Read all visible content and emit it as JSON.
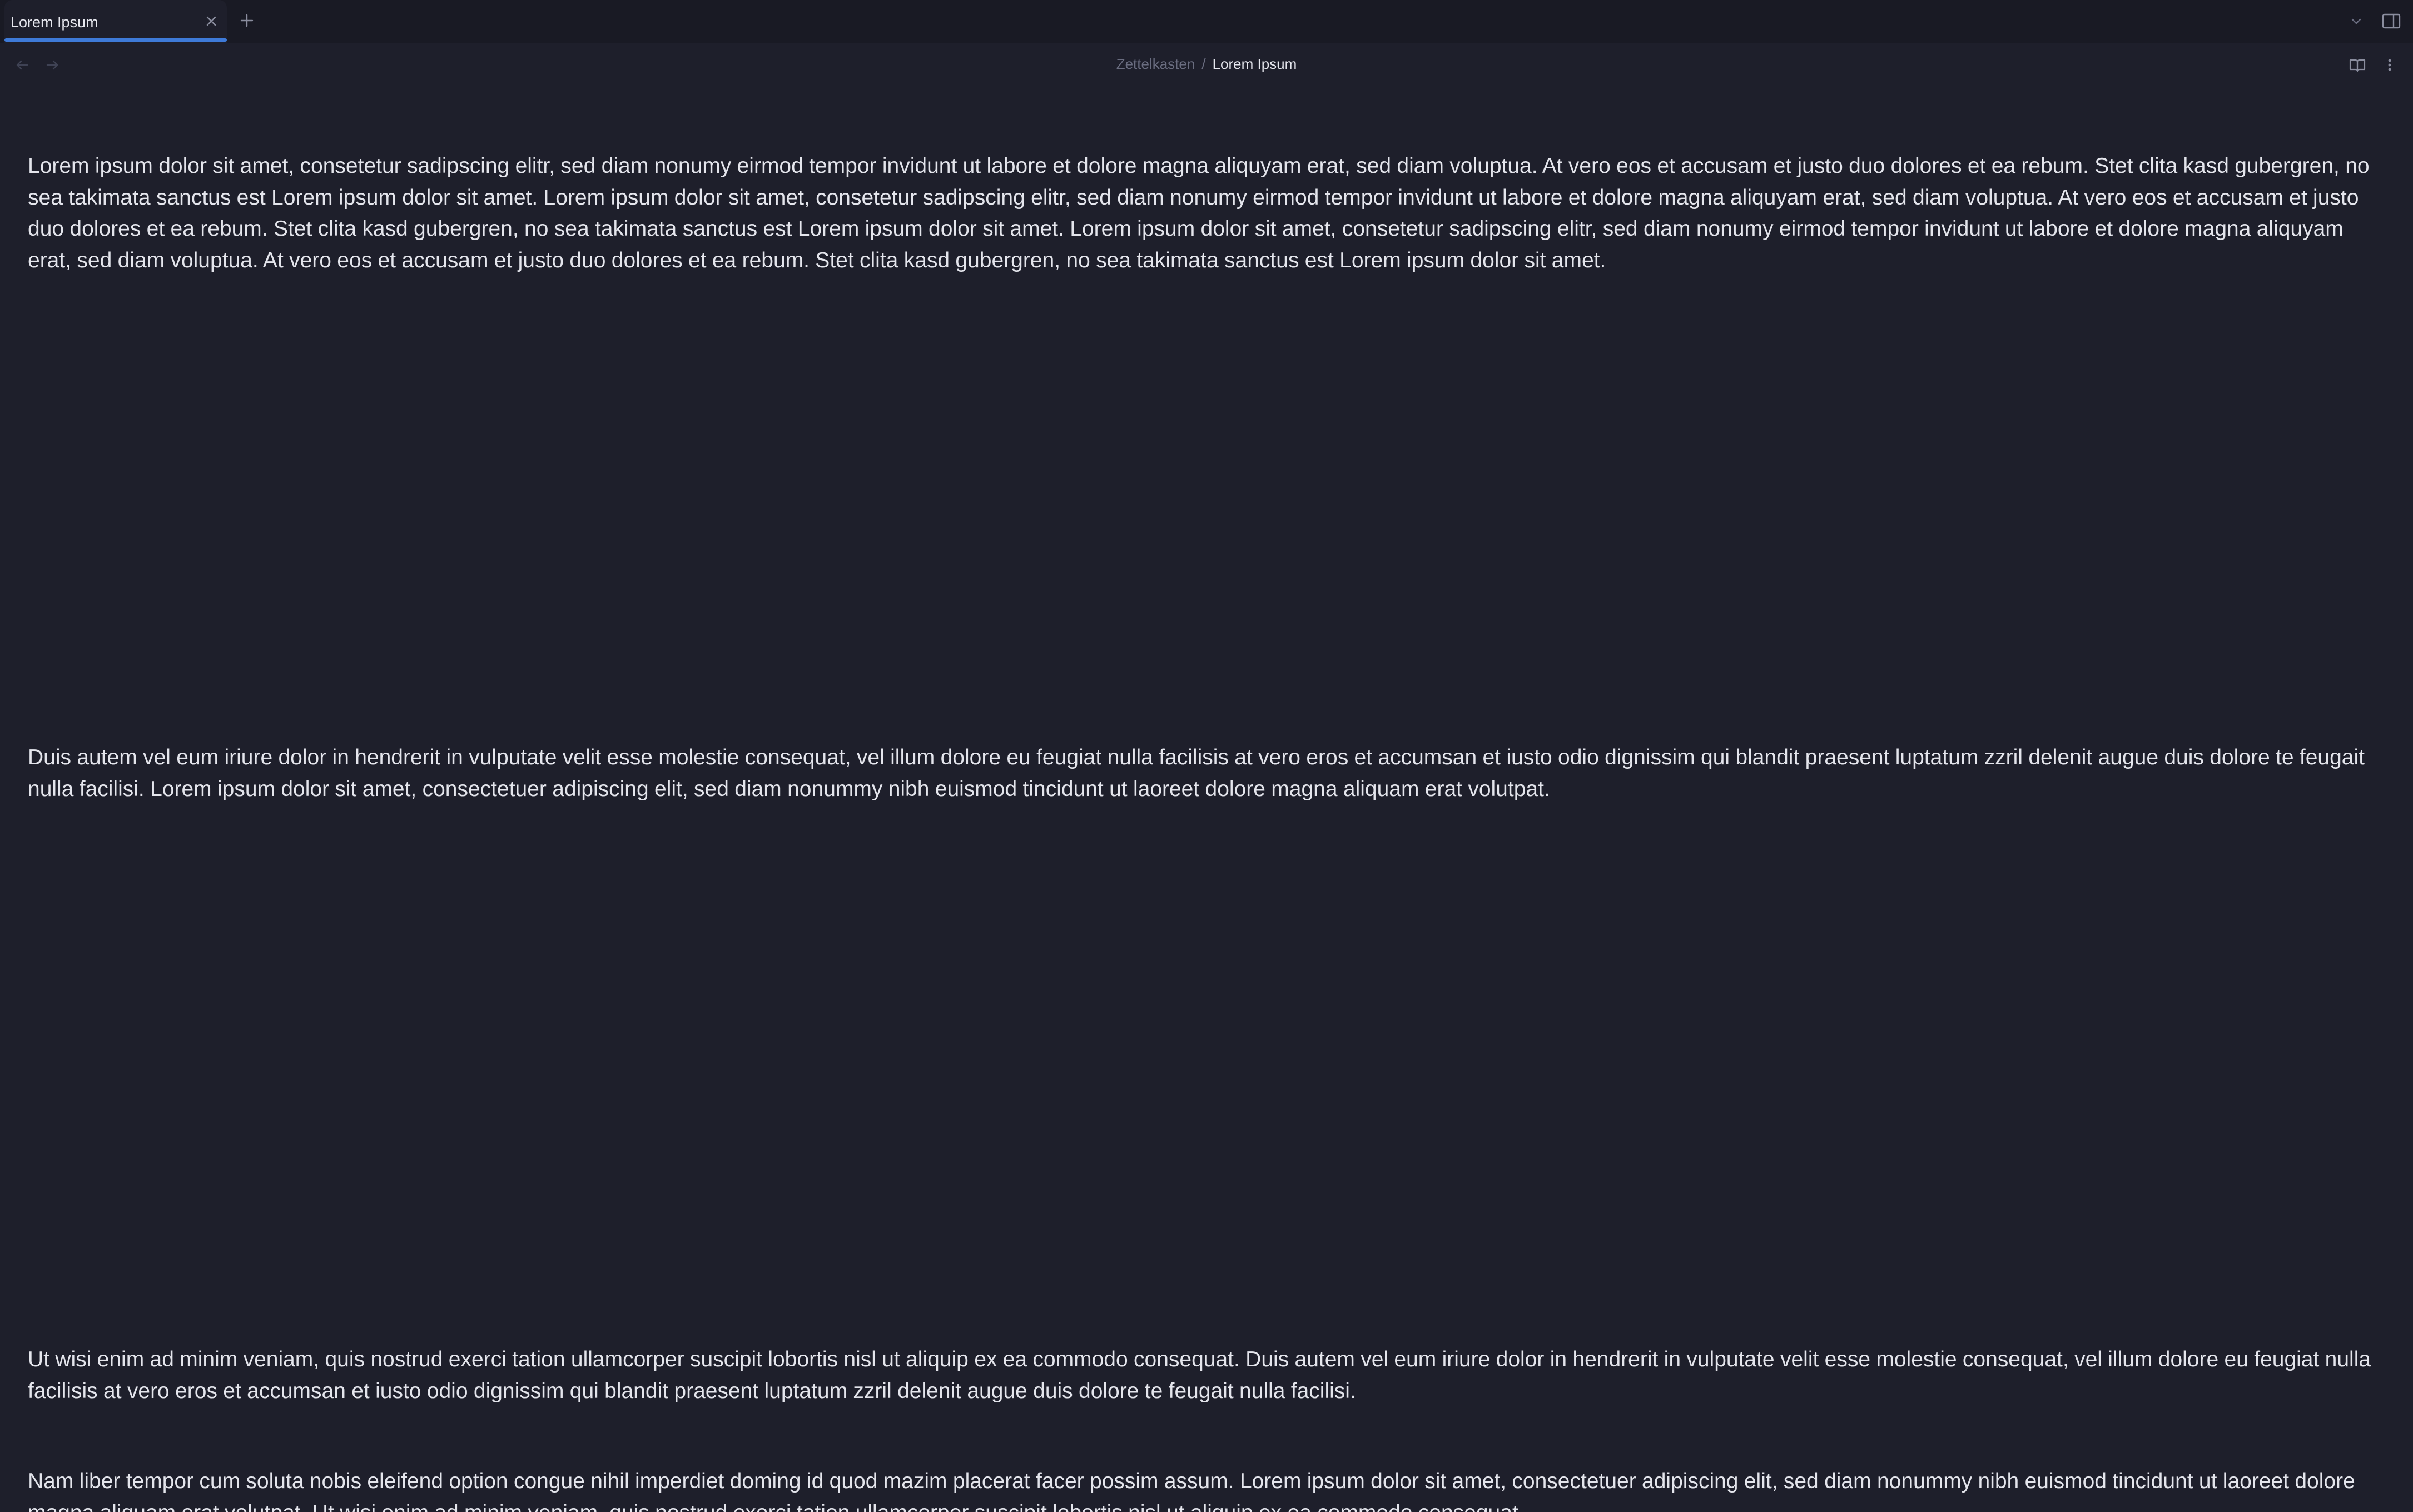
{
  "tabs": [
    {
      "title": "Lorem Ipsum",
      "active": true
    }
  ],
  "icons": {
    "tab_close": "close-icon",
    "tab_new": "plus-icon",
    "tab_list": "chevron-down-icon",
    "sidebar_toggle": "sidebar-right-icon",
    "nav_back": "arrow-left-icon",
    "nav_forward": "arrow-right-icon",
    "reading_view": "book-open-icon",
    "more_options": "more-vertical-icon"
  },
  "breadcrumb": {
    "parent": "Zettelkasten",
    "separator": "/",
    "current": "Lorem Ipsum"
  },
  "document": {
    "paragraphs": [
      "Lorem ipsum dolor sit amet, consetetur sadipscing elitr, sed diam nonumy eirmod tempor invidunt ut labore et dolore magna aliquyam erat, sed diam voluptua. At vero eos et accusam et justo duo dolores et ea rebum. Stet clita kasd gubergren, no sea takimata sanctus est Lorem ipsum dolor sit amet. Lorem ipsum dolor sit amet, consetetur sadipscing elitr, sed diam nonumy eirmod tempor invidunt ut labore et dolore magna aliquyam erat, sed diam voluptua. At vero eos et accusam et justo duo dolores et ea rebum. Stet clita kasd gubergren, no sea takimata sanctus est Lorem ipsum dolor sit amet. Lorem ipsum dolor sit amet, consetetur sadipscing elitr, sed diam nonumy eirmod tempor invidunt ut labore et dolore magna aliquyam erat, sed diam voluptua. At vero eos et accusam et justo duo dolores et ea rebum. Stet clita kasd gubergren, no sea takimata sanctus est Lorem ipsum dolor sit amet.",
      "Duis autem vel eum iriure dolor in hendrerit in vulputate velit esse molestie consequat, vel illum dolore eu feugiat nulla facilisis at vero eros et accumsan et iusto odio dignissim qui blandit praesent luptatum zzril delenit augue duis dolore te feugait nulla facilisi. Lorem ipsum dolor sit amet, consectetuer adipiscing elit, sed diam nonummy nibh euismod tincidunt ut laoreet dolore magna aliquam erat volutpat.",
      "Ut wisi enim ad minim veniam, quis nostrud exerci tation ullamcorper suscipit lobortis nisl ut aliquip ex ea commodo consequat. Duis autem vel eum iriure dolor in hendrerit in vulputate velit esse molestie consequat, vel illum dolore eu feugiat nulla facilisis at vero eros et accumsan et iusto odio dignissim qui blandit praesent luptatum zzril delenit augue duis dolore te feugait nulla facilisi.",
      "Nam liber tempor cum soluta nobis eleifend option congue nihil imperdiet doming id quod mazim placerat facer possim assum. Lorem ipsum dolor sit amet, consectetuer adipiscing elit, sed diam nonummy nibh euismod tincidunt ut laoreet dolore magna aliquam erat volutpat. Ut wisi enim ad minim veniam, quis nostrud exerci tation ullamcorper suscipit lobortis nisl ut aliquip ex ea commodo consequat."
    ]
  },
  "colors": {
    "background": "#1e1f2b",
    "tab_strip": "#191a24",
    "accent": "#3e7ad8",
    "text": "#e4e5ec",
    "muted": "#6a6d80"
  }
}
